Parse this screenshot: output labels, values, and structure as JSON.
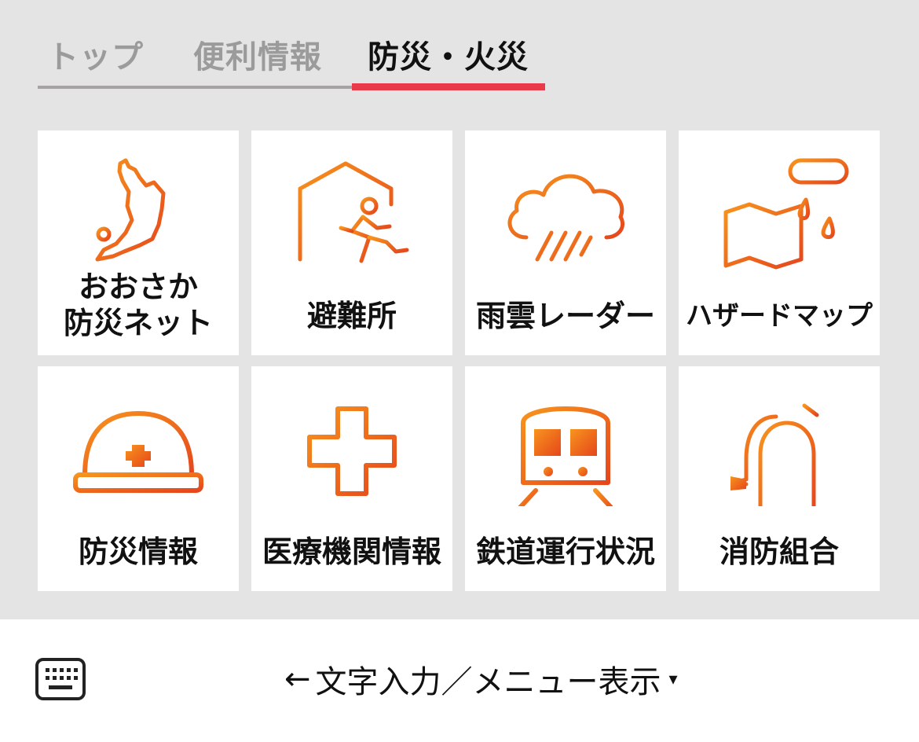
{
  "tabs": [
    {
      "label": "トップ",
      "active": false
    },
    {
      "label": "便利情報",
      "active": false
    },
    {
      "label": "防災・火災",
      "active": true
    }
  ],
  "accent_color": "#e83a48",
  "icon_gradient": [
    "#f47a1f",
    "#e8481c"
  ],
  "tiles": [
    {
      "label": "おおさか\n防災ネット",
      "line1": "おおさか",
      "line2": "防災ネット",
      "icon": "osaka-map-icon"
    },
    {
      "label": "避難所",
      "icon": "evacuation-shelter-icon"
    },
    {
      "label": "雨雲レーダー",
      "icon": "rain-cloud-icon"
    },
    {
      "label": "ハザードマップ",
      "icon": "hazard-map-icon"
    },
    {
      "label": "防災情報",
      "icon": "helmet-icon"
    },
    {
      "label": "医療機関情報",
      "icon": "medical-cross-icon"
    },
    {
      "label": "鉄道運行状況",
      "icon": "train-icon"
    },
    {
      "label": "消防組合",
      "icon": "fire-extinguisher-icon"
    }
  ],
  "footer": {
    "keyboard_icon": "keyboard-icon",
    "arrow": "←",
    "menu_label": "文字入力／メニュー表示",
    "caret": "▾"
  }
}
